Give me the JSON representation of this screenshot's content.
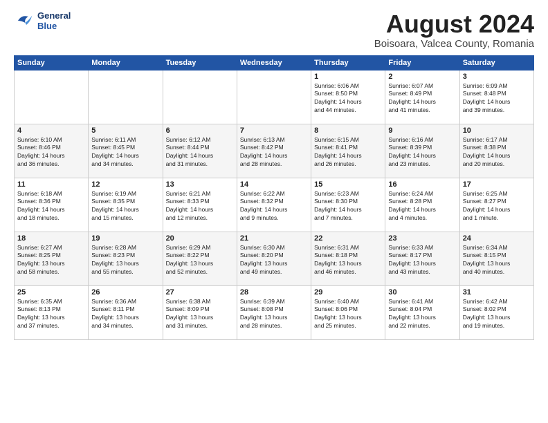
{
  "logo": {
    "line1": "General",
    "line2": "Blue"
  },
  "title": "August 2024",
  "subtitle": "Boisoara, Valcea County, Romania",
  "days_header": [
    "Sunday",
    "Monday",
    "Tuesday",
    "Wednesday",
    "Thursday",
    "Friday",
    "Saturday"
  ],
  "weeks": [
    [
      {
        "day": "",
        "info": ""
      },
      {
        "day": "",
        "info": ""
      },
      {
        "day": "",
        "info": ""
      },
      {
        "day": "",
        "info": ""
      },
      {
        "day": "1",
        "info": "Sunrise: 6:06 AM\nSunset: 8:50 PM\nDaylight: 14 hours\nand 44 minutes."
      },
      {
        "day": "2",
        "info": "Sunrise: 6:07 AM\nSunset: 8:49 PM\nDaylight: 14 hours\nand 41 minutes."
      },
      {
        "day": "3",
        "info": "Sunrise: 6:09 AM\nSunset: 8:48 PM\nDaylight: 14 hours\nand 39 minutes."
      }
    ],
    [
      {
        "day": "4",
        "info": "Sunrise: 6:10 AM\nSunset: 8:46 PM\nDaylight: 14 hours\nand 36 minutes."
      },
      {
        "day": "5",
        "info": "Sunrise: 6:11 AM\nSunset: 8:45 PM\nDaylight: 14 hours\nand 34 minutes."
      },
      {
        "day": "6",
        "info": "Sunrise: 6:12 AM\nSunset: 8:44 PM\nDaylight: 14 hours\nand 31 minutes."
      },
      {
        "day": "7",
        "info": "Sunrise: 6:13 AM\nSunset: 8:42 PM\nDaylight: 14 hours\nand 28 minutes."
      },
      {
        "day": "8",
        "info": "Sunrise: 6:15 AM\nSunset: 8:41 PM\nDaylight: 14 hours\nand 26 minutes."
      },
      {
        "day": "9",
        "info": "Sunrise: 6:16 AM\nSunset: 8:39 PM\nDaylight: 14 hours\nand 23 minutes."
      },
      {
        "day": "10",
        "info": "Sunrise: 6:17 AM\nSunset: 8:38 PM\nDaylight: 14 hours\nand 20 minutes."
      }
    ],
    [
      {
        "day": "11",
        "info": "Sunrise: 6:18 AM\nSunset: 8:36 PM\nDaylight: 14 hours\nand 18 minutes."
      },
      {
        "day": "12",
        "info": "Sunrise: 6:19 AM\nSunset: 8:35 PM\nDaylight: 14 hours\nand 15 minutes."
      },
      {
        "day": "13",
        "info": "Sunrise: 6:21 AM\nSunset: 8:33 PM\nDaylight: 14 hours\nand 12 minutes."
      },
      {
        "day": "14",
        "info": "Sunrise: 6:22 AM\nSunset: 8:32 PM\nDaylight: 14 hours\nand 9 minutes."
      },
      {
        "day": "15",
        "info": "Sunrise: 6:23 AM\nSunset: 8:30 PM\nDaylight: 14 hours\nand 7 minutes."
      },
      {
        "day": "16",
        "info": "Sunrise: 6:24 AM\nSunset: 8:28 PM\nDaylight: 14 hours\nand 4 minutes."
      },
      {
        "day": "17",
        "info": "Sunrise: 6:25 AM\nSunset: 8:27 PM\nDaylight: 14 hours\nand 1 minute."
      }
    ],
    [
      {
        "day": "18",
        "info": "Sunrise: 6:27 AM\nSunset: 8:25 PM\nDaylight: 13 hours\nand 58 minutes."
      },
      {
        "day": "19",
        "info": "Sunrise: 6:28 AM\nSunset: 8:23 PM\nDaylight: 13 hours\nand 55 minutes."
      },
      {
        "day": "20",
        "info": "Sunrise: 6:29 AM\nSunset: 8:22 PM\nDaylight: 13 hours\nand 52 minutes."
      },
      {
        "day": "21",
        "info": "Sunrise: 6:30 AM\nSunset: 8:20 PM\nDaylight: 13 hours\nand 49 minutes."
      },
      {
        "day": "22",
        "info": "Sunrise: 6:31 AM\nSunset: 8:18 PM\nDaylight: 13 hours\nand 46 minutes."
      },
      {
        "day": "23",
        "info": "Sunrise: 6:33 AM\nSunset: 8:17 PM\nDaylight: 13 hours\nand 43 minutes."
      },
      {
        "day": "24",
        "info": "Sunrise: 6:34 AM\nSunset: 8:15 PM\nDaylight: 13 hours\nand 40 minutes."
      }
    ],
    [
      {
        "day": "25",
        "info": "Sunrise: 6:35 AM\nSunset: 8:13 PM\nDaylight: 13 hours\nand 37 minutes."
      },
      {
        "day": "26",
        "info": "Sunrise: 6:36 AM\nSunset: 8:11 PM\nDaylight: 13 hours\nand 34 minutes."
      },
      {
        "day": "27",
        "info": "Sunrise: 6:38 AM\nSunset: 8:09 PM\nDaylight: 13 hours\nand 31 minutes."
      },
      {
        "day": "28",
        "info": "Sunrise: 6:39 AM\nSunset: 8:08 PM\nDaylight: 13 hours\nand 28 minutes."
      },
      {
        "day": "29",
        "info": "Sunrise: 6:40 AM\nSunset: 8:06 PM\nDaylight: 13 hours\nand 25 minutes."
      },
      {
        "day": "30",
        "info": "Sunrise: 6:41 AM\nSunset: 8:04 PM\nDaylight: 13 hours\nand 22 minutes."
      },
      {
        "day": "31",
        "info": "Sunrise: 6:42 AM\nSunset: 8:02 PM\nDaylight: 13 hours\nand 19 minutes."
      }
    ]
  ]
}
